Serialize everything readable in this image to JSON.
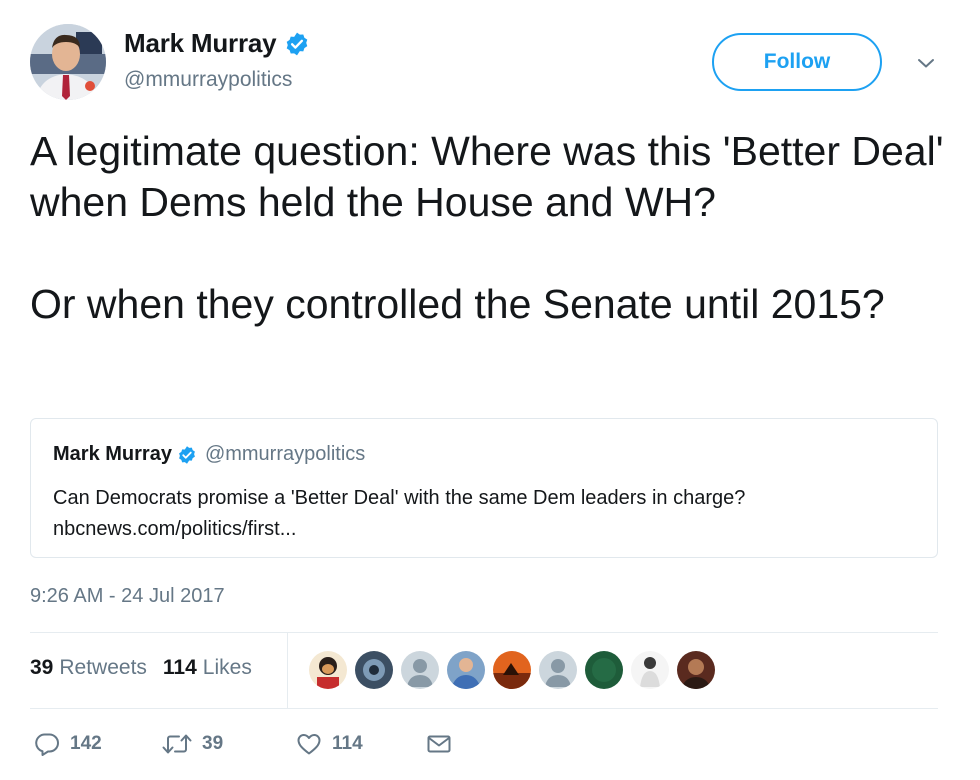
{
  "author": {
    "name": "Mark Murray",
    "handle": "@mmurraypolitics",
    "verified": true
  },
  "follow_button": {
    "label": "Follow"
  },
  "tweet": {
    "text": "A legitimate question: Where was this 'Better Deal' when Dems held the House and WH?\n\nOr when they controlled the Senate until 2015?",
    "timestamp": "9:26 AM - 24 Jul 2017"
  },
  "quoted_tweet": {
    "name": "Mark Murray",
    "handle": "@mmurraypolitics",
    "text": "Can Democrats promise a 'Better Deal' with the same Dem leaders in charge?",
    "link": "nbcnews.com/politics/first..."
  },
  "stats": {
    "retweets_count": "39",
    "retweets_label": "Retweets",
    "likes_count": "114",
    "likes_label": "Likes"
  },
  "actions": {
    "reply_count": "142",
    "retweet_count": "39",
    "like_count": "114"
  },
  "colors": {
    "accent": "#1da1f2",
    "muted": "#657786",
    "text": "#14171a",
    "border": "#e1e8ed"
  },
  "icons": {
    "verified": "verified-badge-icon",
    "caret": "chevron-down-icon",
    "reply": "reply-icon",
    "retweet": "retweet-icon",
    "like": "heart-icon",
    "dm": "envelope-icon"
  }
}
